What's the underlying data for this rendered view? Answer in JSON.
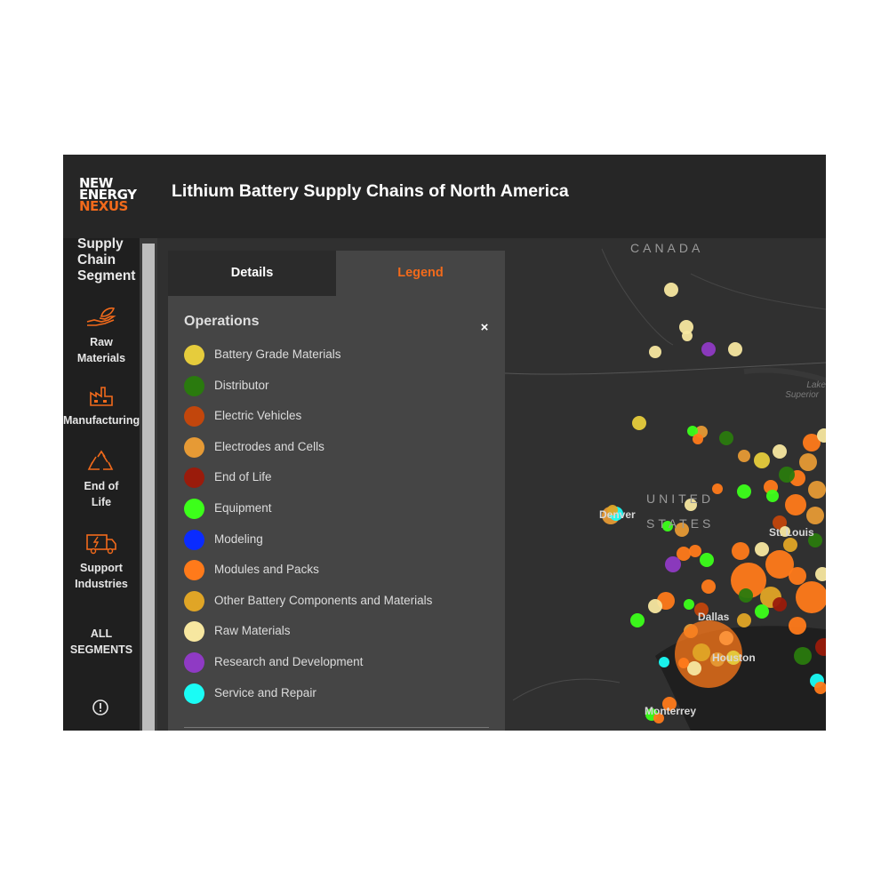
{
  "header": {
    "logo": {
      "line1": "NEW",
      "line2": "ENERGY",
      "line3": "NEXUS"
    },
    "title": "Lithium Battery Supply Chains of North America"
  },
  "sidebar": {
    "heading": "Supply Chain Segment",
    "items": [
      {
        "label": "Raw Materials",
        "icon": "hand-leaf-icon"
      },
      {
        "label": "Manufacturing",
        "icon": "factory-icon"
      },
      {
        "label": "End of Life",
        "icon": "recycle-icon"
      },
      {
        "label": "Support Industries",
        "icon": "truck-battery-icon"
      },
      {
        "label": "ALL SEGMENTS",
        "icon": ""
      }
    ],
    "info_icon": "info-icon"
  },
  "panel": {
    "tabs": [
      {
        "label": "Details",
        "active": false
      },
      {
        "label": "Legend",
        "active": true
      }
    ],
    "legend_heading": "Operations",
    "close_label": "×",
    "legend_items": [
      {
        "label": "Battery Grade Materials",
        "color": "#e6cc3c"
      },
      {
        "label": "Distributor",
        "color": "#2a7a0e"
      },
      {
        "label": "Electric Vehicles",
        "color": "#c2460c"
      },
      {
        "label": "Electrodes and Cells",
        "color": "#e69a35"
      },
      {
        "label": "End of Life",
        "color": "#9a1b0b"
      },
      {
        "label": "Equipment",
        "color": "#3cff1a"
      },
      {
        "label": "Modeling",
        "color": "#0a2bff"
      },
      {
        "label": "Modules and Packs",
        "color": "#ff7a1a"
      },
      {
        "label": "Other Battery Components and Materials",
        "color": "#e0a526"
      },
      {
        "label": "Raw Materials",
        "color": "#f7e7a0"
      },
      {
        "label": "Research and Development",
        "color": "#8f3ac4"
      },
      {
        "label": "Service and Repair",
        "color": "#1afcf5"
      }
    ]
  },
  "map": {
    "labels": [
      {
        "text": "CANADA"
      },
      {
        "text": "UNITED"
      },
      {
        "text": "STATES"
      },
      {
        "text": "Lake"
      },
      {
        "text": "Superior"
      },
      {
        "text": "Denver"
      },
      {
        "text": "St. Louis"
      },
      {
        "text": "Dallas"
      },
      {
        "text": "Houston"
      },
      {
        "text": "Monterrey"
      }
    ]
  },
  "colors": {
    "accent": "#f26a1b",
    "panel": "#454545",
    "header": "#262626",
    "sidebar": "#1f1f1f"
  }
}
